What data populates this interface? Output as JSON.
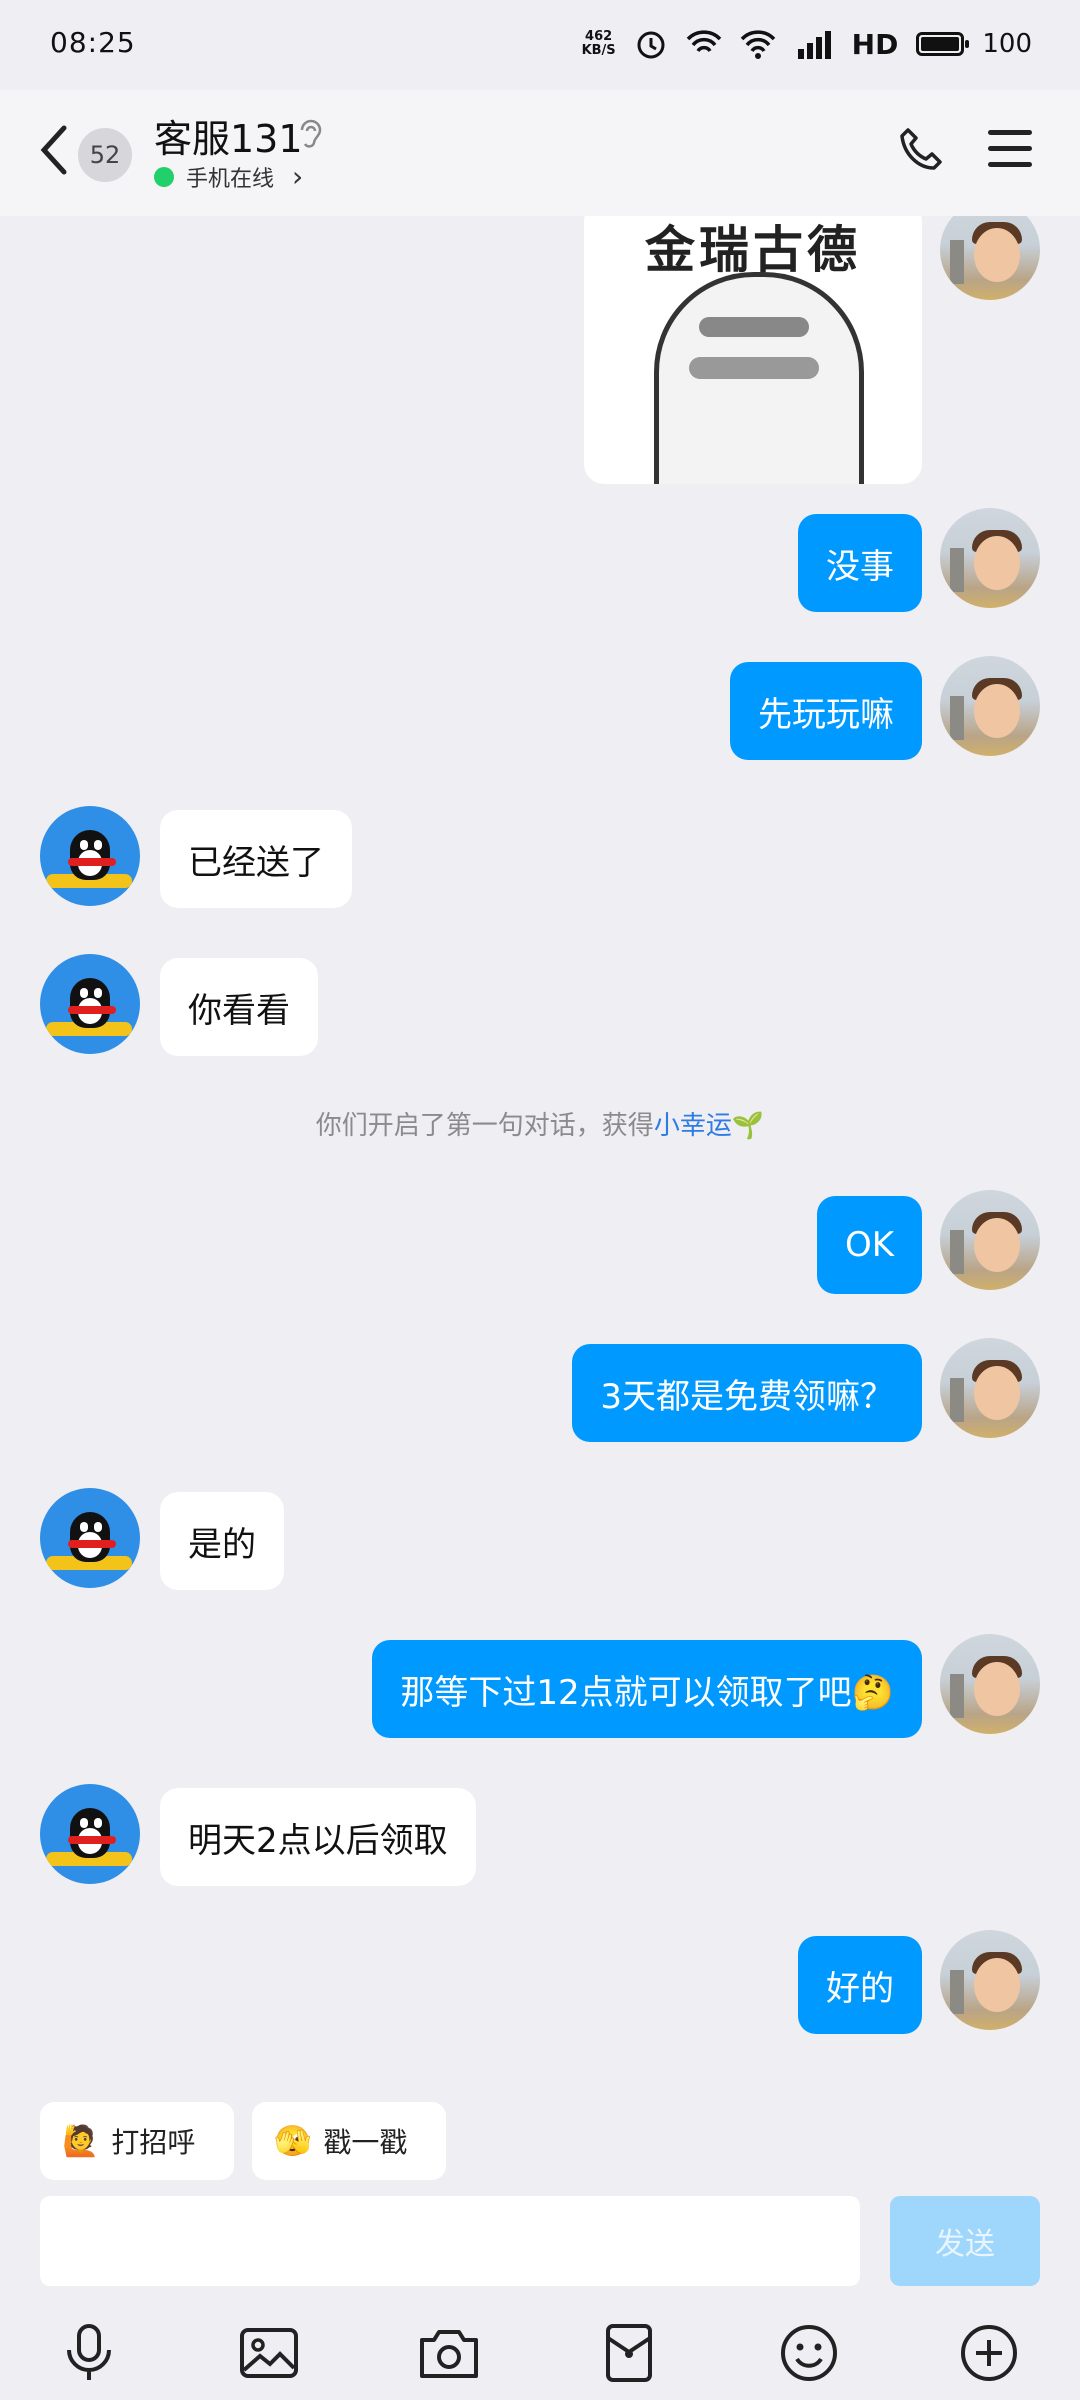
{
  "status_bar": {
    "time": "08:25",
    "net_speed": "462\nKB/S",
    "hd": "HD",
    "battery": "100"
  },
  "header": {
    "unread_count": "52",
    "title": "客服131",
    "online_status": "手机在线"
  },
  "sticker": {
    "text": "金瑞古德"
  },
  "messages": [
    {
      "side": "out",
      "text": "没事"
    },
    {
      "side": "out",
      "text": "先玩玩嘛"
    },
    {
      "side": "in",
      "text": "已经送了"
    },
    {
      "side": "in",
      "text": "你看看"
    },
    {
      "side": "out",
      "text": "OK"
    },
    {
      "side": "out",
      "text": "3天都是免费领嘛？"
    },
    {
      "side": "in",
      "text": "是的"
    },
    {
      "side": "out",
      "text": "那等下过12点就可以领取了吧🤔"
    },
    {
      "side": "in",
      "text": "明天2点以后领取"
    },
    {
      "side": "out",
      "text": "好的"
    }
  ],
  "system_notice": {
    "text": "你们开启了第一句对话，获得",
    "link": "小幸运",
    "emoji": "🌱"
  },
  "quick_replies": [
    {
      "icon": "🙋",
      "label": "打招呼"
    },
    {
      "icon": "🫣",
      "label": "戳一戳"
    }
  ],
  "composer": {
    "placeholder": "",
    "send_label": "发送"
  },
  "colors": {
    "accent": "#0099FF",
    "background": "#EEEEF3",
    "online": "#21D06A"
  }
}
